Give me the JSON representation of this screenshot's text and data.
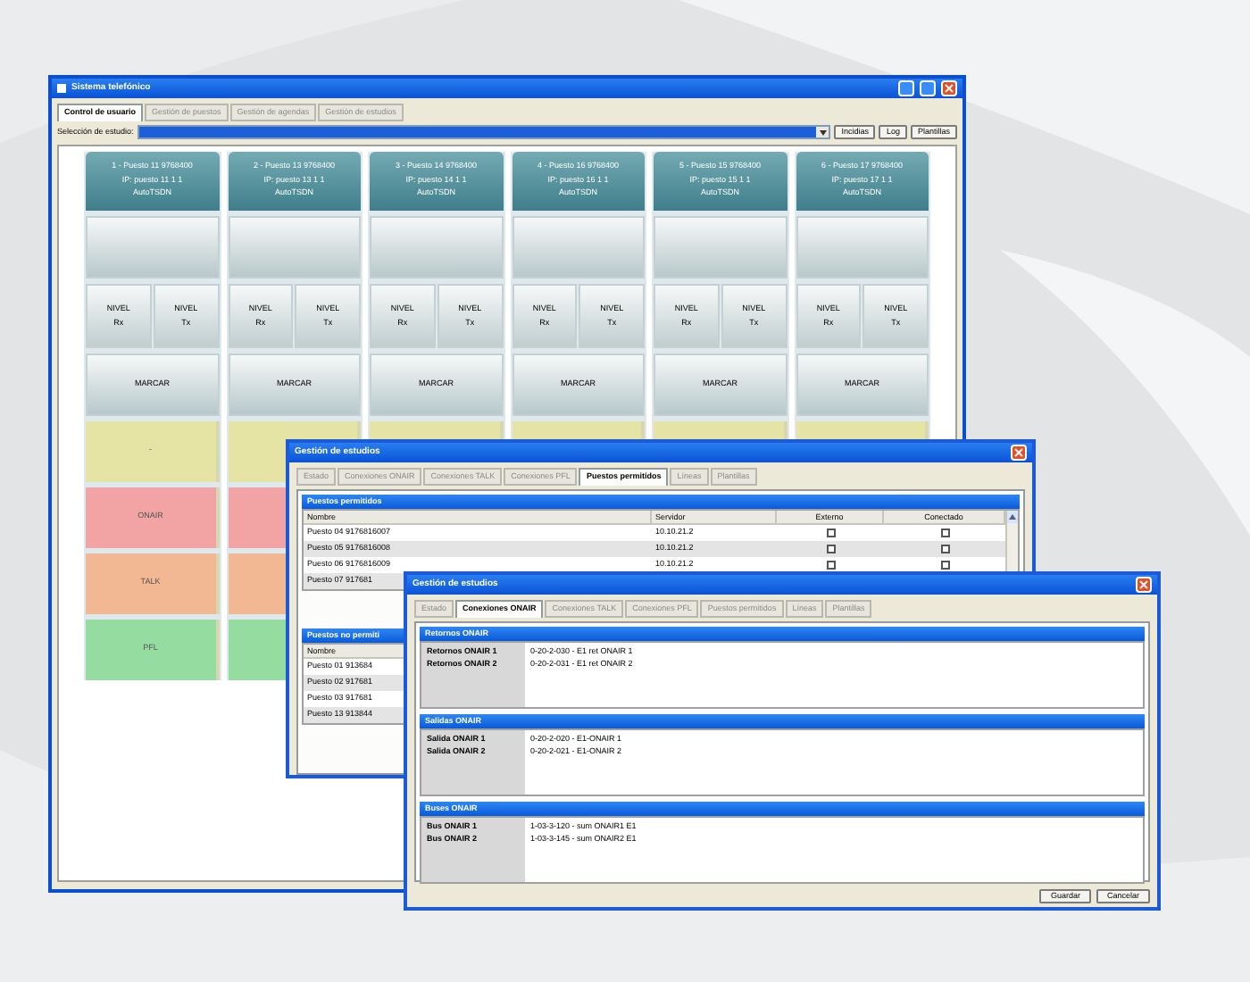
{
  "main_window": {
    "title": "Sistema telefónico",
    "tabs": [
      {
        "label": "Control de usuario",
        "selected": true
      },
      {
        "label": "Gestión de puestos",
        "selected": false
      },
      {
        "label": "Gestión de agendas",
        "selected": false
      },
      {
        "label": "Gestión de estudios",
        "selected": false
      }
    ],
    "selector": {
      "label": "Selección de estudio:",
      "buttons": [
        "Incidias",
        "Log",
        "Plantillas"
      ]
    },
    "columns": [
      {
        "header": [
          "1 - Puesto 11 9768400",
          "IP: puesto 11 1 1",
          "AutoTSDN"
        ],
        "buttons": [
          {
            "kind": "blank"
          },
          {
            "kind": "level",
            "labels": [
              "NIVEL\nRx",
              "NIVEL\nTx"
            ]
          },
          {
            "kind": "action",
            "label": "MARCAR"
          },
          {
            "kind": "state",
            "color": "#e6e4a4",
            "label": "-"
          },
          {
            "kind": "state",
            "color": "#f2a4a4",
            "label": "ONAIR"
          },
          {
            "kind": "state",
            "color": "#f2b894",
            "label": "TALK"
          },
          {
            "kind": "state",
            "color": "#94dca0",
            "label": "PFL"
          }
        ]
      },
      {
        "header": [
          "2 - Puesto 13 9768400",
          "IP: puesto 13 1 1",
          "AutoTSDN"
        ],
        "buttons": [
          {
            "kind": "blank"
          },
          {
            "kind": "level",
            "labels": [
              "NIVEL\nRx",
              "NIVEL\nTx"
            ]
          },
          {
            "kind": "action",
            "label": "MARCAR"
          },
          {
            "kind": "state",
            "color": "#e6e4a4"
          },
          {
            "kind": "state",
            "color": "#f2a4a4"
          },
          {
            "kind": "state",
            "color": "#f2b894"
          },
          {
            "kind": "state",
            "color": "#94dca0"
          }
        ]
      },
      {
        "header": [
          "3 - Puesto 14 9768400",
          "IP: puesto 14 1 1",
          "AutoTSDN"
        ],
        "buttons": [
          {
            "kind": "blank"
          },
          {
            "kind": "level",
            "labels": [
              "NIVEL\nRx",
              "NIVEL\nTx"
            ]
          },
          {
            "kind": "action",
            "label": "MARCAR"
          },
          {
            "kind": "state",
            "color": "#e6e4a4"
          }
        ]
      },
      {
        "header": [
          "4 - Puesto 16 9768400",
          "IP: puesto 16 1 1",
          "AutoTSDN"
        ],
        "buttons": [
          {
            "kind": "blank"
          },
          {
            "kind": "level",
            "labels": [
              "NIVEL\nRx",
              "NIVEL\nTx"
            ]
          },
          {
            "kind": "action",
            "label": "MARCAR"
          },
          {
            "kind": "state",
            "color": "#e6e4a4"
          }
        ]
      },
      {
        "header": [
          "5 - Puesto 15 9768400",
          "IP: puesto 15 1 1",
          "AutoTSDN"
        ],
        "buttons": [
          {
            "kind": "blank"
          },
          {
            "kind": "level",
            "labels": [
              "NIVEL\nRx",
              "NIVEL\nTx"
            ]
          },
          {
            "kind": "action",
            "label": "MARCAR"
          },
          {
            "kind": "state",
            "color": "#e6e4a4"
          }
        ]
      },
      {
        "header": [
          "6 - Puesto 17 9768400",
          "IP: puesto 17 1 1",
          "AutoTSDN"
        ],
        "buttons": [
          {
            "kind": "blank"
          },
          {
            "kind": "level",
            "labels": [
              "NIVEL\nRx",
              "NIVEL\nTx"
            ]
          },
          {
            "kind": "action",
            "label": "MARCAR"
          },
          {
            "kind": "state",
            "color": "#e6e4a4"
          }
        ]
      }
    ]
  },
  "dialogs": [
    {
      "title": "Gestión de estudios",
      "tabs": [
        {
          "label": "Estado",
          "selected": false
        },
        {
          "label": "Conexiones ONAIR",
          "selected": false
        },
        {
          "label": "Conexiones TALK",
          "selected": false
        },
        {
          "label": "Conexiones PFL",
          "selected": false
        },
        {
          "label": "Puestos permitidos",
          "selected": true
        },
        {
          "label": "Líneas",
          "selected": false
        },
        {
          "label": "Plantillas",
          "selected": false
        }
      ],
      "sections": [
        {
          "kind": "table",
          "title": "Puestos permitidos",
          "columns": [
            "Nombre",
            "Servidor",
            "Externo",
            "Conectado"
          ],
          "rows": [
            {
              "cells": [
                "Puesto 04 9176816007",
                "10.10.21.2"
              ],
              "checks": [
                false,
                false
              ]
            },
            {
              "cells": [
                "Puesto 05 9176816008",
                "10.10.21.2"
              ],
              "checks": [
                false,
                false
              ]
            },
            {
              "cells": [
                "Puesto 06 9176816009",
                "10.10.21.2"
              ],
              "checks": [
                false,
                false
              ]
            },
            {
              "cells": [
                "Puesto 07 917681"
              ]
            }
          ]
        },
        {
          "kind": "table",
          "title": "Puestos no permiti",
          "columns": [
            "Nombre"
          ],
          "rows": [
            {
              "cells": [
                "Puesto 01 913684"
              ]
            },
            {
              "cells": [
                "Puesto 02 917681"
              ]
            },
            {
              "cells": [
                "Puesto 03 917681"
              ]
            },
            {
              "cells": [
                "Puesto 13 913844"
              ]
            }
          ]
        }
      ]
    },
    {
      "title": "Gestión de estudios",
      "tabs": [
        {
          "label": "Estado",
          "selected": false
        },
        {
          "label": "Conexiones ONAIR",
          "selected": true
        },
        {
          "label": "Conexiones TALK",
          "selected": false
        },
        {
          "label": "Conexiones PFL",
          "selected": false
        },
        {
          "label": "Puestos permitidos",
          "selected": false
        },
        {
          "label": "Líneas",
          "selected": false
        },
        {
          "label": "Plantillas",
          "selected": false
        }
      ],
      "sections": [
        {
          "kind": "list",
          "title": "Retornos ONAIR",
          "items": [
            {
              "label": "Retornos ONAIR 1",
              "value": "0-20-2-030 - E1 ret ONAIR 1"
            },
            {
              "label": "Retornos ONAIR 2",
              "value": "0-20-2-031 - E1 ret ONAIR 2"
            }
          ]
        },
        {
          "kind": "list",
          "title": "Salidas ONAIR",
          "items": [
            {
              "label": "Salida ONAIR 1",
              "value": "0-20-2-020 - E1-ONAIR 1"
            },
            {
              "label": "Salida ONAIR 2",
              "value": "0-20-2-021 - E1-ONAIR 2"
            }
          ]
        },
        {
          "kind": "list",
          "title": "Buses ONAIR",
          "items": [
            {
              "label": "Bus ONAIR 1",
              "value": "1-03-3-120 - sum ONAIR1 E1"
            },
            {
              "label": "Bus ONAIR 2",
              "value": "1-03-3-145 - sum ONAIR2 E1"
            }
          ]
        }
      ],
      "buttons": [
        "Guardar",
        "Cancelar"
      ]
    }
  ]
}
